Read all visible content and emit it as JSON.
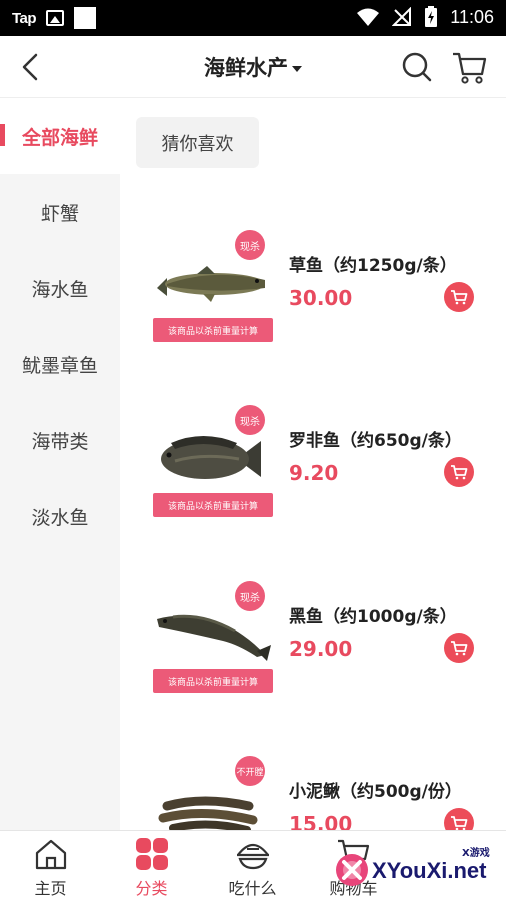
{
  "status_bar": {
    "carrier_label": "Tap",
    "time": "11:06"
  },
  "header": {
    "title": "海鲜水产"
  },
  "sidebar": {
    "items": [
      {
        "label": "全部海鲜",
        "active": true
      },
      {
        "label": "虾蟹",
        "active": false
      },
      {
        "label": "海水鱼",
        "active": false
      },
      {
        "label": "鱿墨章鱼",
        "active": false
      },
      {
        "label": "海带类",
        "active": false
      },
      {
        "label": "淡水鱼",
        "active": false
      }
    ]
  },
  "main": {
    "chip_label": "猜你喜欢",
    "products": [
      {
        "name": "草鱼（约1250g/条）",
        "price": "30.00",
        "badge": "现杀",
        "banner": "该商品以杀前重量计算"
      },
      {
        "name": "罗非鱼（约650g/条）",
        "price": "9.20",
        "badge": "现杀",
        "banner": "该商品以杀前重量计算"
      },
      {
        "name": "黑鱼（约1000g/条）",
        "price": "29.00",
        "badge": "现杀",
        "banner": "该商品以杀前重量计算"
      },
      {
        "name": "小泥鳅（约500g/份）",
        "price": "15.00",
        "badge": "不开膛",
        "banner": ""
      }
    ]
  },
  "bottom_nav": {
    "tabs": [
      {
        "label": "主页",
        "icon": "home-icon"
      },
      {
        "label": "分类",
        "icon": "category-icon",
        "active": true
      },
      {
        "label": "吃什么",
        "icon": "food-icon"
      },
      {
        "label": "购物车",
        "icon": "cart-icon"
      }
    ]
  },
  "watermark": {
    "text": "XYouXi.net",
    "small": "X游戏"
  },
  "colors": {
    "accent": "#e84a5f",
    "badge_pink": "#ec5a78",
    "sidebar_bg": "#f5f5f5"
  }
}
